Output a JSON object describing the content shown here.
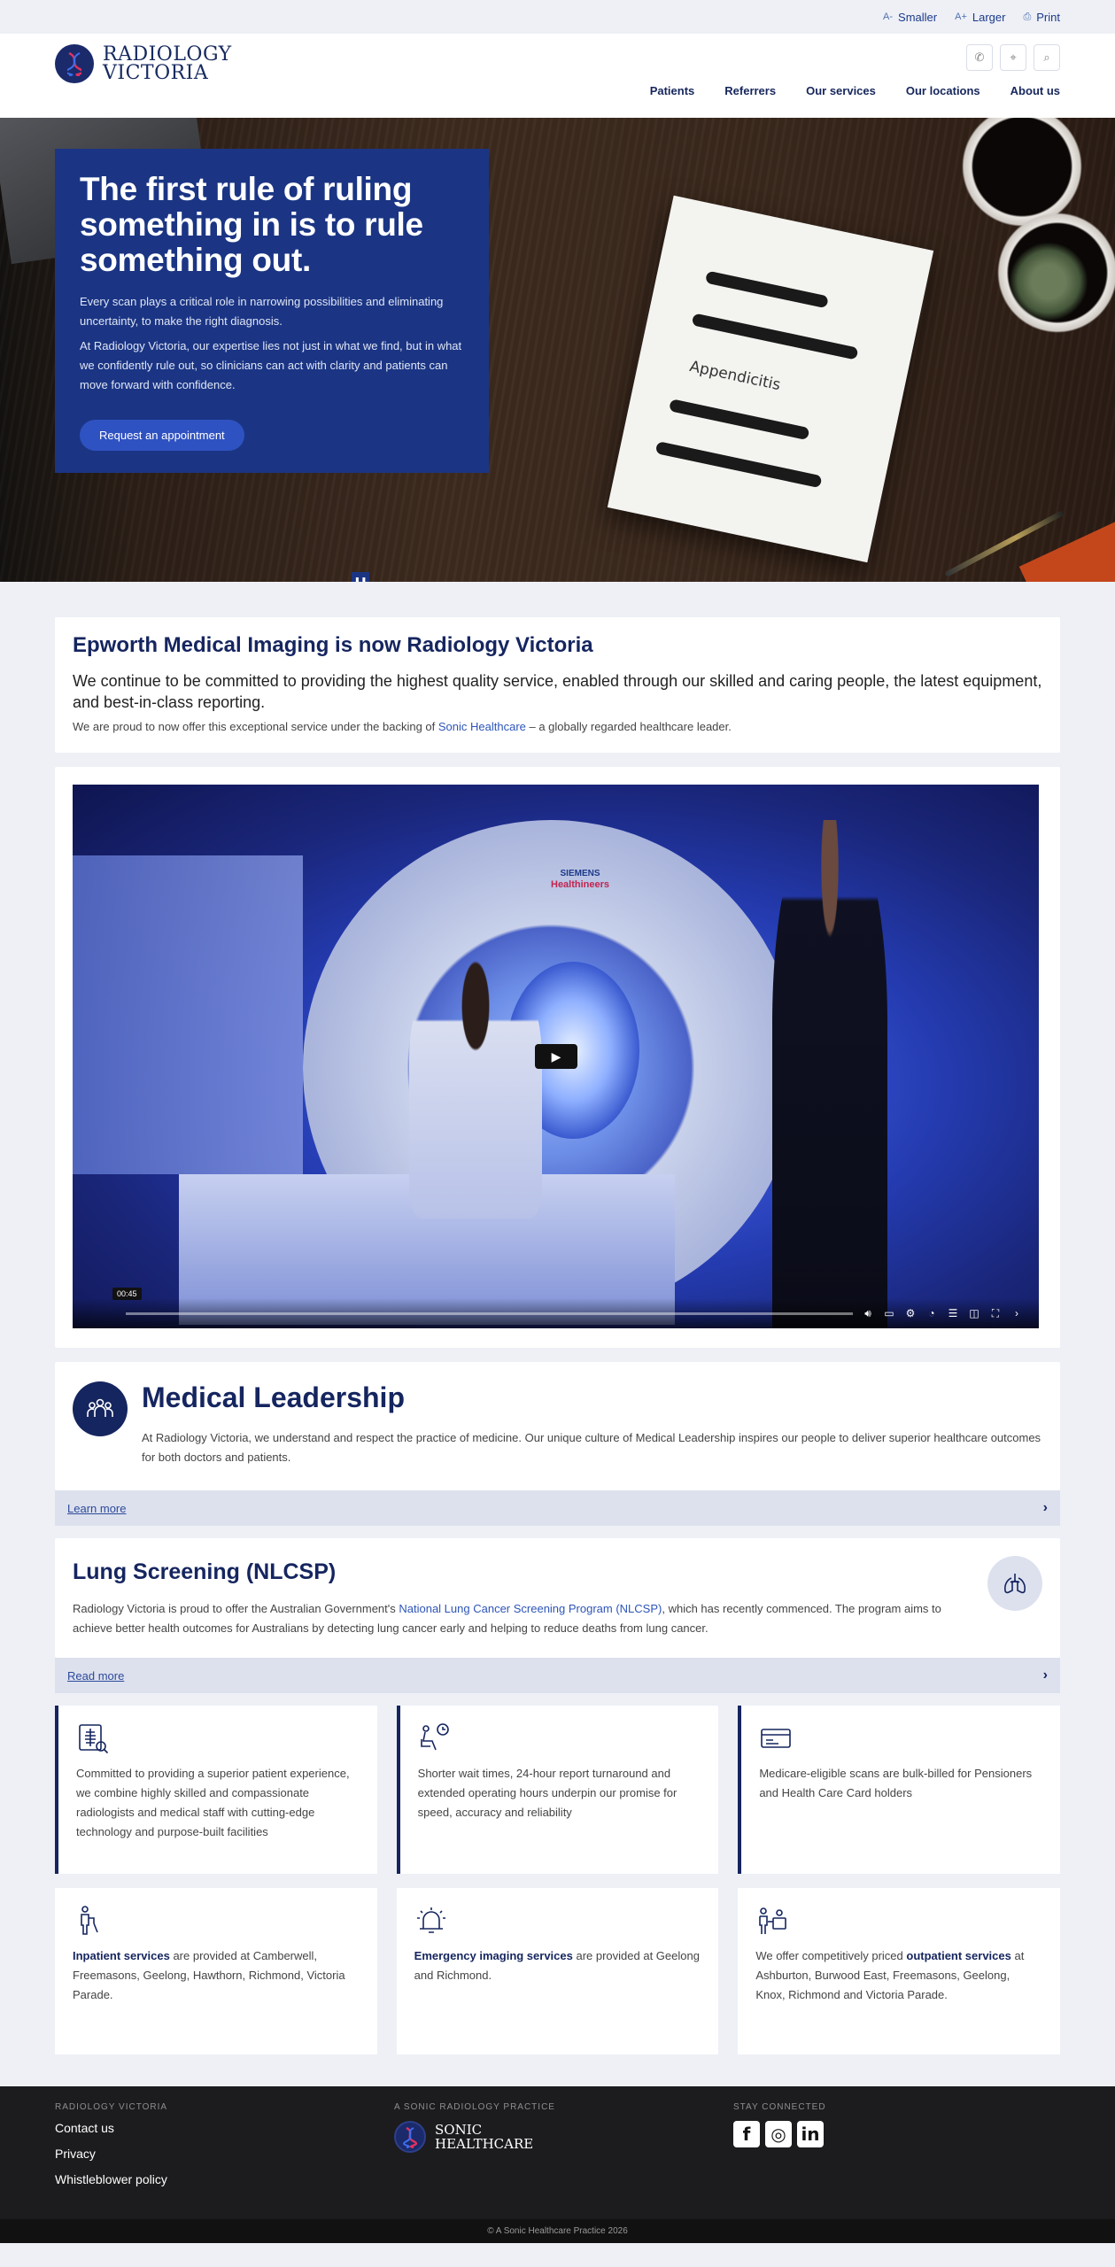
{
  "topbar": {
    "smaller": "Smaller",
    "larger": "Larger",
    "print": "Print"
  },
  "header": {
    "logo_line1": "RADIOLOGY",
    "logo_line2": "VICTORIA",
    "nav": [
      "Patients",
      "Referrers",
      "Our services",
      "Our locations",
      "About us"
    ]
  },
  "hero": {
    "title": "The first rule of ruling something in is to rule something out.",
    "para1": "Every scan plays a critical role in narrowing possibilities and eliminating uncertainty, to make the right diagnosis.",
    "para2": "At Radiology Victoria, our expertise lies not just in what we find, but in what we confidently rule out, so clinicians can act with clarity and patients can move forward with confidence.",
    "cta": "Request an appointment",
    "paper_text": "Appendicitis"
  },
  "intro": {
    "title": "Epworth Medical Imaging is now Radiology Victoria",
    "lead": "We continue to be committed to providing the highest quality service, enabled through our skilled and caring people, the latest equipment, and best-in-class reporting.",
    "small_pre": "We are proud to now offer this exceptional service under the backing of ",
    "small_link": "Sonic Healthcare",
    "small_post": " – a globally regarded healthcare leader."
  },
  "video": {
    "time": "00:45",
    "brand_top": "SIEMENS",
    "brand_bottom": "Healthineers",
    "progress": 0
  },
  "leadership": {
    "title": "Medical Leadership",
    "text": "At Radiology Victoria, we understand and respect the practice of medicine. Our unique culture of Medical Leadership inspires our people to deliver superior healthcare outcomes for both doctors and patients.",
    "more": "Learn more"
  },
  "lung": {
    "title": "Lung Screening (NLCSP)",
    "text_pre": "Radiology Victoria is proud to offer the Australian Government's ",
    "text_link": "National Lung Cancer Screening Program (NLCSP)",
    "text_post": ", which has recently commenced. The program aims to achieve better health outcomes for Australians by detecting lung cancer early and helping to reduce deaths from lung cancer.",
    "more": "Read more"
  },
  "features": [
    {
      "icon": "xray-icon",
      "text": "Committed to providing a superior patient experience, we combine highly skilled and compassionate radiologists and medical staff with cutting-edge technology and purpose-built facilities"
    },
    {
      "icon": "waiting-clock-icon",
      "text": "Shorter wait times, 24-hour report turnaround and extended operating hours underpin our promise for speed, accuracy and reliability"
    },
    {
      "icon": "medicare-card-icon",
      "text": "Medicare-eligible scans are bulk-billed for Pensioners and Health Care Card holders"
    }
  ],
  "services": [
    {
      "icon": "inpatient-icon",
      "bold": "Inpatient services",
      "text": " are provided at Camberwell, Freemasons, Geelong, Hawthorn, Richmond, Victoria Parade."
    },
    {
      "icon": "emergency-bell-icon",
      "bold": "Emergency imaging services",
      "text": " are provided at Geelong and Richmond."
    },
    {
      "icon": "outpatient-icon",
      "pre": "We offer competitively priced ",
      "bold": "outpatient services",
      "text": " at Ashburton, Burwood East, Freemasons, Geelong, Knox, Richmond and Victoria Parade."
    }
  ],
  "footer": {
    "col1_head": "RADIOLOGY VICTORIA",
    "links": [
      "Contact us",
      "Privacy",
      "Whistleblower policy"
    ],
    "col2_head": "A SONIC RADIOLOGY PRACTICE",
    "sonic1": "SONIC",
    "sonic2": "HEALTHCARE",
    "col3_head": "STAY CONNECTED",
    "social": [
      "f",
      "◎",
      "in"
    ],
    "copyright": "© A Sonic Healthcare Practice 2026"
  },
  "colors": {
    "brand_navy": "#15255f",
    "hero_panel": "#1b3584",
    "link_blue": "#2d55b8",
    "cta_blue": "#2f52c2"
  }
}
